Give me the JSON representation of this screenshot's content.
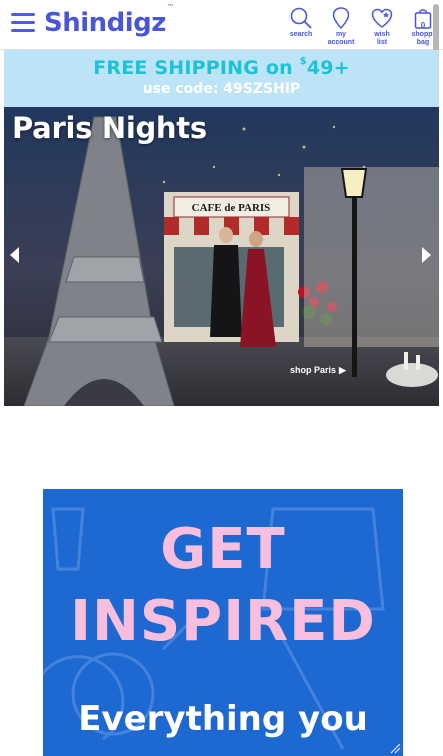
{
  "header": {
    "logo_text": "Shindigz",
    "logo_tm": "™",
    "search_label": "search",
    "account_label_1": "my",
    "account_label_2": "account",
    "wishlist_label_1": "wish",
    "wishlist_label_2": "list",
    "bag_label_1": "shoppi",
    "bag_label_2": "bag",
    "bag_count": "0"
  },
  "promo": {
    "line1_prefix": "FREE SHIPPING on ",
    "currency": "$",
    "amount": "49+",
    "line2": "use code: 49SZSHIP"
  },
  "hero": {
    "title": "Paris Nights",
    "cta": "shop Paris",
    "sign_text": "CAFE de PARIS"
  },
  "ad": {
    "line1": "GET",
    "line2": "INSPIRED",
    "line3": "Everything you"
  },
  "colors": {
    "brand": "#4a56d8",
    "promo_bg": "#bde3f6",
    "promo_accent": "#1bc3d8",
    "ad_bg": "#1e68d2",
    "ad_text": "#f7bfdd"
  }
}
